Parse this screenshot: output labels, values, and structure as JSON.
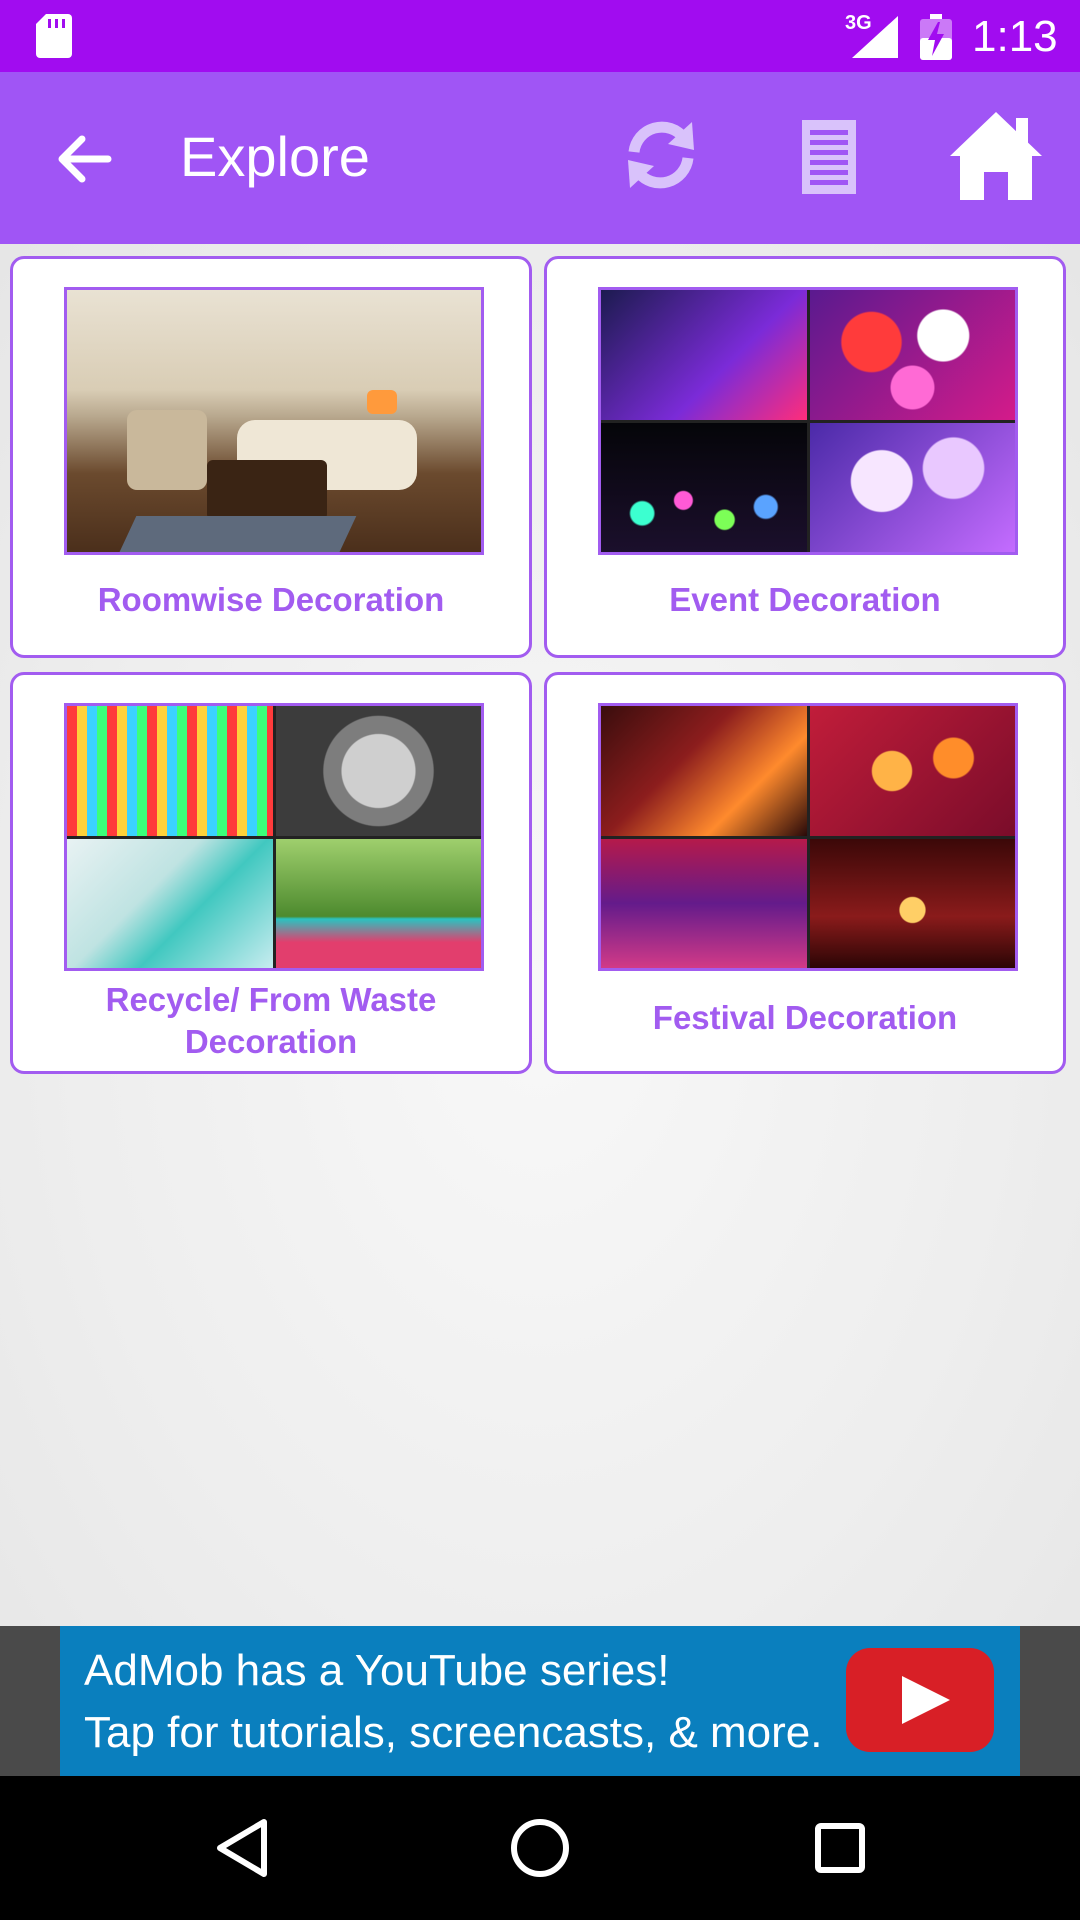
{
  "status_bar": {
    "network": "3G",
    "time": "1:13"
  },
  "app_bar": {
    "title": "Explore",
    "icons": [
      "back-arrow-icon",
      "refresh-icon",
      "list-icon",
      "home-icon"
    ]
  },
  "cards": [
    {
      "label": "Roomwise Decoration",
      "thumb": "living-room-photo"
    },
    {
      "label": "Event Decoration",
      "thumb": "event-lights-collage"
    },
    {
      "label": "Recycle/ From Waste Decoration",
      "label_line1": "Recycle/ From Waste",
      "label_line2": "Decoration",
      "thumb": "recycled-crafts-collage"
    },
    {
      "label": "Festival Decoration",
      "thumb": "festival-lamps-collage"
    }
  ],
  "ad": {
    "line1": "AdMob has a YouTube series!",
    "line2": "Tap for tutorials, screencasts, & more."
  },
  "colors": {
    "status_bar": "#a10cf0",
    "app_bar": "#a055f5",
    "accent": "#a25cf0",
    "ad_banner": "#0a7fbe"
  }
}
